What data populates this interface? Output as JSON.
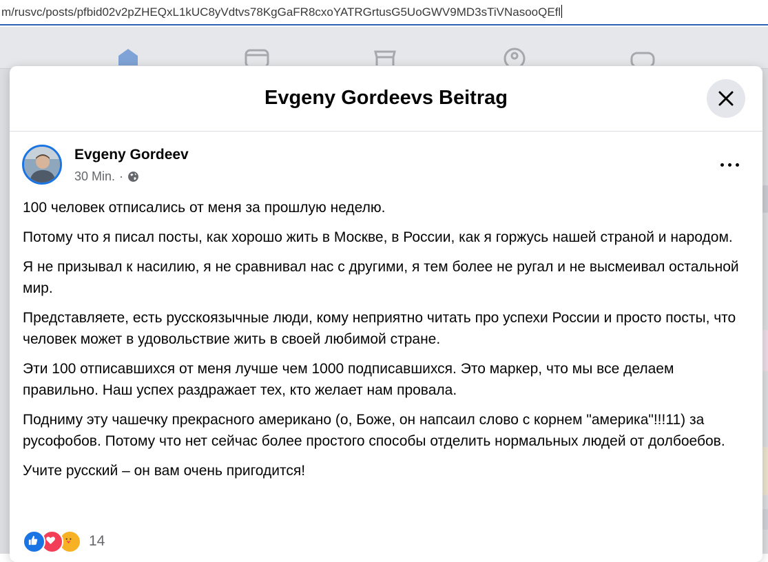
{
  "browser": {
    "url": "m/rusvc/posts/pfbid02v2pZHEQxL1kUC8yVdtvs78KgGaFR8cxoYATRGrtusG5UoGWV9MD3sTiVNasooQEfl"
  },
  "nav": {
    "icons": [
      "home-icon",
      "video-icon",
      "marketplace-icon",
      "groups-icon",
      "gaming-icon"
    ],
    "accent": "#1b74e4"
  },
  "modal": {
    "title": "Evgeny Gordeevs Beitrag"
  },
  "post": {
    "author": "Evgeny Gordeev",
    "time": "30 Min.",
    "separator": "·",
    "audience_icon": "globe-icon",
    "paragraphs": [
      "100 человек отписались от меня за прошлую неделю.",
      "Потому что я писал посты, как хорошо жить в Москве, в России, как я горжусь нашей страной и народом.",
      "Я не призывал к насилию, я не сравнивал нас с другими, я тем более не ругал и не высмеивал остальной мир.",
      "Представляете, есть русскоязычные люди, кому неприятно читать про успехи России и просто посты, что человек может в удовольствие жить в своей любимой стране.",
      "Эти 100 отписавшихся от меня лучше чем 1000 подписавшихся. Это маркер, что мы все делаем правильно. Наш успех раздражает тех, кто желает нам провала.",
      "Подниму эту чашечку прекрасного американо (о, Боже, он напсаил слово с корнем \"америка\"!!!11) за русофобов. Потому что нет сейчас более простого способы отделить нормальных людей от долбоебов.",
      "Учите русский – он вам очень пригодится!"
    ],
    "reactions": {
      "types": [
        "like",
        "love",
        "care"
      ],
      "count": "14"
    }
  }
}
